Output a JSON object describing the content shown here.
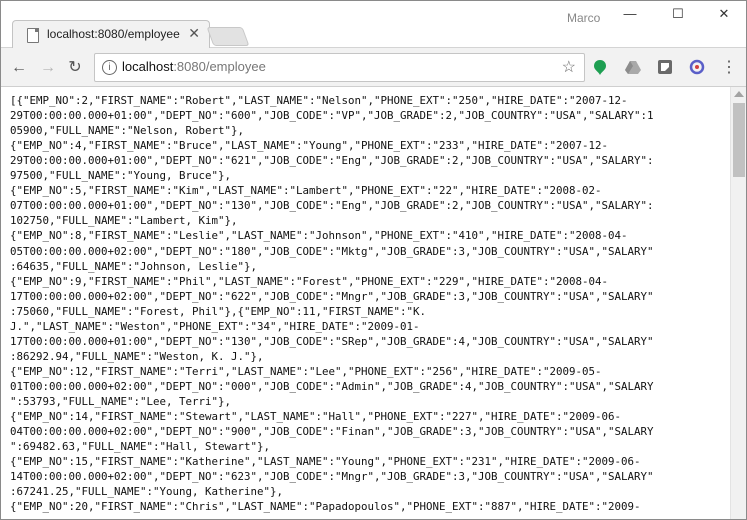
{
  "window": {
    "user": "Marco",
    "controls": {
      "minimize": "—",
      "maximize": "☐",
      "close": "✕"
    }
  },
  "tab": {
    "title": "localhost:8080/employee",
    "close": "✕"
  },
  "address_bar": {
    "host": "localhost",
    "path": ":8080/employee"
  },
  "nav": {
    "back": "←",
    "forward": "→",
    "reload": "↻",
    "star": "☆",
    "info": "i"
  },
  "content_lines": [
    "[{\"EMP_NO\":2,\"FIRST_NAME\":\"Robert\",\"LAST_NAME\":\"Nelson\",\"PHONE_EXT\":\"250\",\"HIRE_DATE\":\"2007-12-",
    "29T00:00:00.000+01:00\",\"DEPT_NO\":\"600\",\"JOB_CODE\":\"VP\",\"JOB_GRADE\":2,\"JOB_COUNTRY\":\"USA\",\"SALARY\":1",
    "05900,\"FULL_NAME\":\"Nelson, Robert\"},",
    "{\"EMP_NO\":4,\"FIRST_NAME\":\"Bruce\",\"LAST_NAME\":\"Young\",\"PHONE_EXT\":\"233\",\"HIRE_DATE\":\"2007-12-",
    "29T00:00:00.000+01:00\",\"DEPT_NO\":\"621\",\"JOB_CODE\":\"Eng\",\"JOB_GRADE\":2,\"JOB_COUNTRY\":\"USA\",\"SALARY\":",
    "97500,\"FULL_NAME\":\"Young, Bruce\"},",
    "{\"EMP_NO\":5,\"FIRST_NAME\":\"Kim\",\"LAST_NAME\":\"Lambert\",\"PHONE_EXT\":\"22\",\"HIRE_DATE\":\"2008-02-",
    "07T00:00:00.000+01:00\",\"DEPT_NO\":\"130\",\"JOB_CODE\":\"Eng\",\"JOB_GRADE\":2,\"JOB_COUNTRY\":\"USA\",\"SALARY\":",
    "102750,\"FULL_NAME\":\"Lambert, Kim\"},",
    "{\"EMP_NO\":8,\"FIRST_NAME\":\"Leslie\",\"LAST_NAME\":\"Johnson\",\"PHONE_EXT\":\"410\",\"HIRE_DATE\":\"2008-04-",
    "05T00:00:00.000+02:00\",\"DEPT_NO\":\"180\",\"JOB_CODE\":\"Mktg\",\"JOB_GRADE\":3,\"JOB_COUNTRY\":\"USA\",\"SALARY\"",
    ":64635,\"FULL_NAME\":\"Johnson, Leslie\"},",
    "{\"EMP_NO\":9,\"FIRST_NAME\":\"Phil\",\"LAST_NAME\":\"Forest\",\"PHONE_EXT\":\"229\",\"HIRE_DATE\":\"2008-04-",
    "17T00:00:00.000+02:00\",\"DEPT_NO\":\"622\",\"JOB_CODE\":\"Mngr\",\"JOB_GRADE\":3,\"JOB_COUNTRY\":\"USA\",\"SALARY\"",
    ":75060,\"FULL_NAME\":\"Forest, Phil\"},{\"EMP_NO\":11,\"FIRST_NAME\":\"K.",
    "J.\",\"LAST_NAME\":\"Weston\",\"PHONE_EXT\":\"34\",\"HIRE_DATE\":\"2009-01-",
    "17T00:00:00.000+01:00\",\"DEPT_NO\":\"130\",\"JOB_CODE\":\"SRep\",\"JOB_GRADE\":4,\"JOB_COUNTRY\":\"USA\",\"SALARY\"",
    ":86292.94,\"FULL_NAME\":\"Weston, K. J.\"},",
    "{\"EMP_NO\":12,\"FIRST_NAME\":\"Terri\",\"LAST_NAME\":\"Lee\",\"PHONE_EXT\":\"256\",\"HIRE_DATE\":\"2009-05-",
    "01T00:00:00.000+02:00\",\"DEPT_NO\":\"000\",\"JOB_CODE\":\"Admin\",\"JOB_GRADE\":4,\"JOB_COUNTRY\":\"USA\",\"SALARY",
    "\":53793,\"FULL_NAME\":\"Lee, Terri\"},",
    "{\"EMP_NO\":14,\"FIRST_NAME\":\"Stewart\",\"LAST_NAME\":\"Hall\",\"PHONE_EXT\":\"227\",\"HIRE_DATE\":\"2009-06-",
    "04T00:00:00.000+02:00\",\"DEPT_NO\":\"900\",\"JOB_CODE\":\"Finan\",\"JOB_GRADE\":3,\"JOB_COUNTRY\":\"USA\",\"SALARY",
    "\":69482.63,\"FULL_NAME\":\"Hall, Stewart\"},",
    "{\"EMP_NO\":15,\"FIRST_NAME\":\"Katherine\",\"LAST_NAME\":\"Young\",\"PHONE_EXT\":\"231\",\"HIRE_DATE\":\"2009-06-",
    "14T00:00:00.000+02:00\",\"DEPT_NO\":\"623\",\"JOB_CODE\":\"Mngr\",\"JOB_GRADE\":3,\"JOB_COUNTRY\":\"USA\",\"SALARY\"",
    ":67241.25,\"FULL_NAME\":\"Young, Katherine\"},",
    "{\"EMP_NO\":20,\"FIRST_NAME\":\"Chris\",\"LAST_NAME\":\"Papadopoulos\",\"PHONE_EXT\":\"887\",\"HIRE_DATE\":\"2009-"
  ]
}
